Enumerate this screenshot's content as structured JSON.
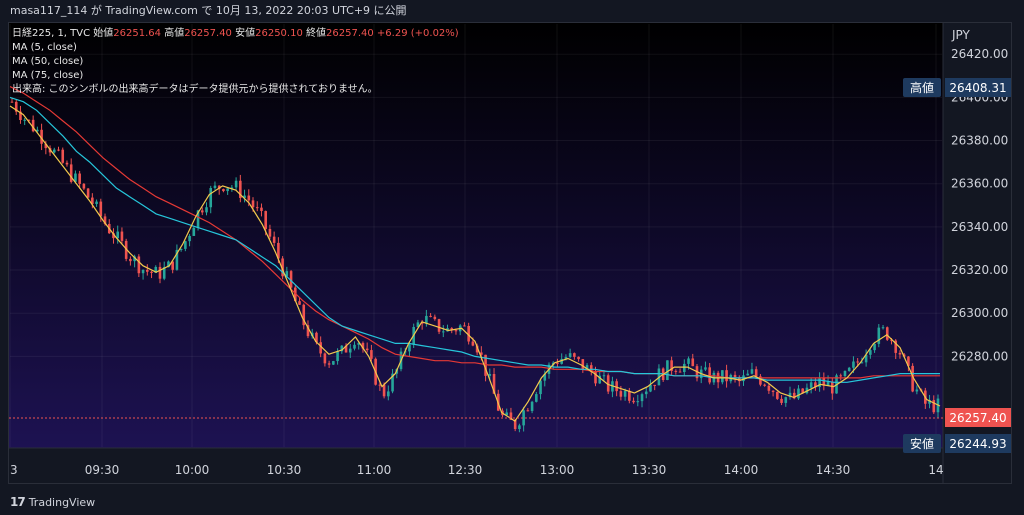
{
  "header": {
    "publish_line": "masa117_114 が TradingView.com で 10月 13, 2022 20:03 UTC+9 に公開"
  },
  "legend": {
    "symbol": "日経225, 1, TVC",
    "open_label": "始値",
    "open_value": "26251.64",
    "high_label": "高値",
    "high_value": "26257.40",
    "low_label": "安値",
    "low_value": "26250.10",
    "close_label": "終値",
    "close_value": "26257.40",
    "change": "+6.29 (+0.02%)",
    "ma5": "MA (5, close)",
    "ma50": "MA (50, close)",
    "ma75": "MA (75, close)",
    "volume_notice": "出来高: このシンボルの出来高データはデータ提供元から提供されておりません。"
  },
  "axis": {
    "currency": "JPY",
    "y_ticks": [
      "26420.00",
      "26400.00",
      "26380.00",
      "26360.00",
      "26340.00",
      "26320.00",
      "26300.00",
      "26280.00"
    ],
    "x_ticks": [
      "3",
      "09:30",
      "10:00",
      "10:30",
      "11:00",
      "12:30",
      "13:00",
      "13:30",
      "14:00",
      "14:30",
      "14"
    ],
    "high_tag_label": "高値",
    "high_tag_value": "26408.31",
    "low_tag_label": "安値",
    "low_tag_value": "26244.93",
    "last_price": "26257.40"
  },
  "footer": {
    "brand": "TradingView"
  },
  "colors": {
    "up": "#26a69a",
    "down": "#ef5350",
    "ma5": "#f2c94c",
    "ma50": "#26c6da",
    "ma75": "#e53935",
    "bg_top": "#000000",
    "bg_bottom": "#1d1252"
  },
  "chart_data": {
    "type": "line",
    "x_ticks": [
      "3",
      "09:30",
      "10:00",
      "10:30",
      "11:00",
      "12:30",
      "13:00",
      "13:30",
      "14:00",
      "14:30",
      "14"
    ],
    "ylim": [
      26238,
      26434
    ],
    "price_path": [
      26398,
      26390,
      26384,
      26376,
      26368,
      26360,
      26352,
      26342,
      26334,
      26326,
      26320,
      26318,
      26322,
      26332,
      26346,
      26356,
      26360,
      26358,
      26352,
      26342,
      26328,
      26312,
      26296,
      26284,
      26278,
      26282,
      26290,
      26278,
      26262,
      26272,
      26288,
      26298,
      26294,
      26292,
      26294,
      26288,
      26270,
      26252,
      26248,
      26258,
      26270,
      26278,
      26280,
      26276,
      26272,
      26266,
      26264,
      26262,
      26266,
      26272,
      26276,
      26276,
      26272,
      26270,
      26270,
      26268,
      26272,
      26268,
      26262,
      26260,
      26264,
      26268,
      26266,
      26270,
      26278,
      26288,
      26292,
      26284,
      26268,
      26258,
      26257
    ],
    "ma5": [
      26396,
      26392,
      26384,
      26376,
      26368,
      26360,
      26352,
      26343,
      26335,
      26328,
      26322,
      26319,
      26322,
      26332,
      26345,
      26355,
      26359,
      26357,
      26351,
      26341,
      26328,
      26313,
      26298,
      26287,
      26281,
      26283,
      26289,
      26280,
      26266,
      26272,
      26286,
      26296,
      26294,
      26292,
      26293,
      26287,
      26271,
      26254,
      26250,
      26259,
      26270,
      26277,
      26279,
      26276,
      26272,
      26267,
      26265,
      26263,
      26266,
      26271,
      26275,
      26275,
      26272,
      26270,
      26270,
      26269,
      26271,
      26268,
      26263,
      26261,
      26264,
      26267,
      26266,
      26270,
      26277,
      26286,
      26290,
      26284,
      26270,
      26260,
      26257
    ],
    "ma50": [
      26400,
      26398,
      26394,
      26388,
      26382,
      26375,
      26370,
      26364,
      26358,
      26354,
      26350,
      26346,
      26344,
      26342,
      26340,
      26338,
      26336,
      26334,
      26330,
      26326,
      26322,
      26316,
      26310,
      26304,
      26298,
      26294,
      26292,
      26290,
      26288,
      26286,
      26286,
      26285,
      26284,
      26283,
      26282,
      26280,
      26279,
      26278,
      26277,
      26276,
      26276,
      26275,
      26275,
      26274,
      26274,
      26273,
      26273,
      26272,
      26272,
      26272,
      26271,
      26271,
      26271,
      26270,
      26270,
      26270,
      26270,
      26269,
      26269,
      26269,
      26269,
      26269,
      26268,
      26268,
      26269,
      26270,
      26271,
      26272,
      26272,
      26272,
      26272
    ],
    "ma75": [
      26405,
      26402,
      26398,
      26394,
      26389,
      26384,
      26378,
      26372,
      26367,
      26362,
      26358,
      26354,
      26351,
      26348,
      26345,
      26342,
      26338,
      26334,
      26329,
      26324,
      26318,
      26312,
      26306,
      26301,
      26297,
      26294,
      26291,
      26288,
      26284,
      26281,
      26280,
      26279,
      26278,
      26278,
      26277,
      26277,
      26276,
      26276,
      26275,
      26275,
      26275,
      26274,
      26274,
      26274,
      26273,
      26273,
      26273,
      26272,
      26272,
      26272,
      26271,
      26271,
      26271,
      26271,
      26270,
      26270,
      26270,
      26270,
      26270,
      26270,
      26270,
      26270,
      26270,
      26270,
      26270,
      26271,
      26271,
      26271,
      26271,
      26271,
      26271
    ]
  }
}
